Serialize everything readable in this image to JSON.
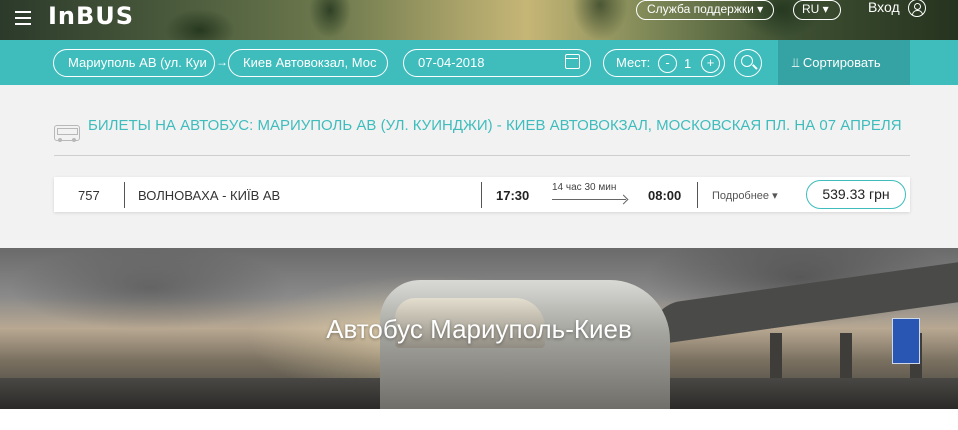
{
  "header": {
    "logo": "InBUS",
    "support": "Служба поддержки ▾",
    "language": "RU ▾",
    "login": "Вход"
  },
  "search": {
    "from": "Мариуполь АВ (ул. Куи",
    "to": "Киев Автовокзал, Мос",
    "date": "07-04-2018",
    "seats_label": "Мест:",
    "seats_value": "1",
    "minus": "-",
    "plus": "+",
    "sort": "⫫ Сортировать"
  },
  "results": {
    "title": "Билеты на автобус: Мариуполь АВ (ул. Куинджи) - Киев Автовокзал, Московская пл. на 07 апреля",
    "trips": [
      {
        "number": "757",
        "route": "ВОЛНОВАХА - КИЇВ АВ",
        "departure": "17:30",
        "duration": "14 час 30 мин",
        "arrival": "08:00",
        "details": "Подробнее ▾",
        "price": "539.33 грн"
      }
    ]
  },
  "hero": {
    "text": "Автобус Мариуполь-Киев"
  },
  "colors": {
    "accent": "#3fbdbd",
    "accent_dark": "#35a3a3"
  }
}
